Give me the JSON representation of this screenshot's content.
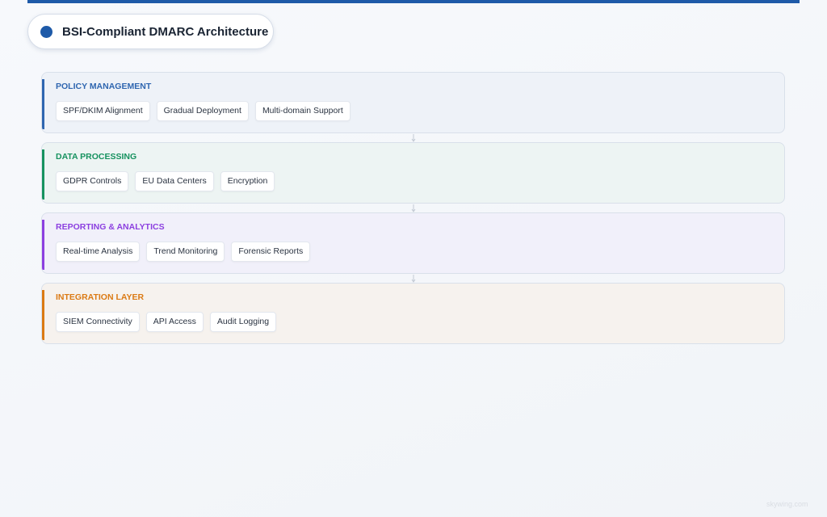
{
  "title": "BSI-Compliant DMARC Architecture",
  "colors": {
    "accent_primary": "#1e5aa8",
    "policy": "#2f66b0",
    "data": "#16925f",
    "reporting": "#8c3fe0",
    "integration": "#db7a14"
  },
  "layers": [
    {
      "title": "POLICY MANAGEMENT",
      "color": "#2f66b0",
      "components": [
        "SPF/DKIM Alignment",
        "Gradual Deployment",
        "Multi-domain Support"
      ]
    },
    {
      "title": "DATA PROCESSING",
      "color": "#16925f",
      "components": [
        "GDPR Controls",
        "EU Data Centers",
        "Encryption"
      ]
    },
    {
      "title": "REPORTING & ANALYTICS",
      "color": "#8c3fe0",
      "components": [
        "Real-time Analysis",
        "Trend Monitoring",
        "Forensic Reports"
      ]
    },
    {
      "title": "INTEGRATION LAYER",
      "color": "#db7a14",
      "components": [
        "SIEM Connectivity",
        "API Access",
        "Audit Logging"
      ]
    }
  ],
  "watermark": "skywing.com"
}
